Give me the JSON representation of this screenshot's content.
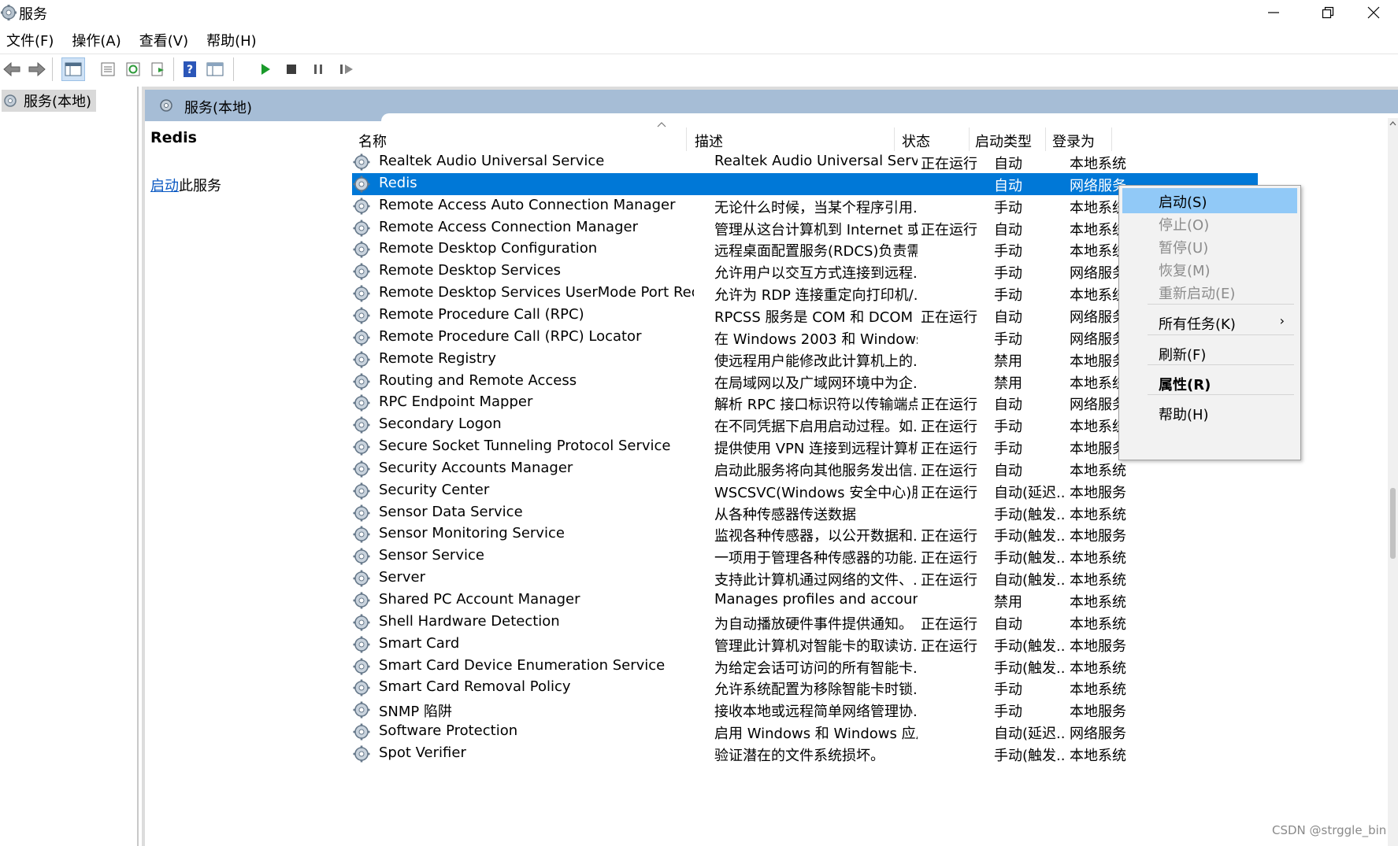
{
  "window": {
    "title": "服务"
  },
  "menu": [
    "文件(F)",
    "操作(A)",
    "查看(V)",
    "帮助(H)"
  ],
  "tree": {
    "root_label": "服务(本地)"
  },
  "pane": {
    "header": "服务(本地)"
  },
  "detail": {
    "service_name": "Redis",
    "action_link": "启动",
    "action_suffix": "此服务"
  },
  "columns": {
    "name": "名称",
    "desc": "描述",
    "status": "状态",
    "startup": "启动类型",
    "logon": "登录为"
  },
  "services": [
    {
      "name": "Realtek Audio Universal Service",
      "desc": "Realtek Audio Universal Service",
      "status": "正在运行",
      "startup": "自动",
      "logon": "本地系统"
    },
    {
      "name": "Redis",
      "desc": "",
      "status": "",
      "startup": "自动",
      "logon": "网络服务"
    },
    {
      "name": "Remote Access Auto Connection Manager",
      "desc": "无论什么时候，当某个程序引用...",
      "status": "",
      "startup": "手动",
      "logon": "本地系统"
    },
    {
      "name": "Remote Access Connection Manager",
      "desc": "管理从这台计算机到 Internet 或...",
      "status": "正在运行",
      "startup": "自动",
      "logon": "本地系统"
    },
    {
      "name": "Remote Desktop Configuration",
      "desc": "远程桌面配置服务(RDCS)负责需...",
      "status": "",
      "startup": "手动",
      "logon": "本地系统"
    },
    {
      "name": "Remote Desktop Services",
      "desc": "允许用户以交互方式连接到远程...",
      "status": "",
      "startup": "手动",
      "logon": "网络服务"
    },
    {
      "name": "Remote Desktop Services UserMode Port Redirector",
      "desc": "允许为 RDP 连接重定向打印机/...",
      "status": "",
      "startup": "手动",
      "logon": "本地系统"
    },
    {
      "name": "Remote Procedure Call (RPC)",
      "desc": "RPCSS 服务是 COM 和 DCOM ...",
      "status": "正在运行",
      "startup": "自动",
      "logon": "网络服务"
    },
    {
      "name": "Remote Procedure Call (RPC) Locator",
      "desc": "在 Windows 2003 和 Windows ...",
      "status": "",
      "startup": "手动",
      "logon": "网络服务"
    },
    {
      "name": "Remote Registry",
      "desc": "使远程用户能修改此计算机上的...",
      "status": "",
      "startup": "禁用",
      "logon": "本地服务"
    },
    {
      "name": "Routing and Remote Access",
      "desc": "在局域网以及广域网环境中为企...",
      "status": "",
      "startup": "禁用",
      "logon": "本地系统"
    },
    {
      "name": "RPC Endpoint Mapper",
      "desc": "解析 RPC 接口标识符以传输端点...",
      "status": "正在运行",
      "startup": "自动",
      "logon": "网络服务"
    },
    {
      "name": "Secondary Logon",
      "desc": "在不同凭据下启用启动过程。如...",
      "status": "正在运行",
      "startup": "手动",
      "logon": "本地系统"
    },
    {
      "name": "Secure Socket Tunneling Protocol Service",
      "desc": "提供使用 VPN 连接到远程计算机...",
      "status": "正在运行",
      "startup": "手动",
      "logon": "本地服务"
    },
    {
      "name": "Security Accounts Manager",
      "desc": "启动此服务将向其他服务发出信...",
      "status": "正在运行",
      "startup": "自动",
      "logon": "本地系统"
    },
    {
      "name": "Security Center",
      "desc": "WSCSVC(Windows 安全中心)服...",
      "status": "正在运行",
      "startup": "自动(延迟...",
      "logon": "本地服务"
    },
    {
      "name": "Sensor Data Service",
      "desc": "从各种传感器传送数据",
      "status": "",
      "startup": "手动(触发...",
      "logon": "本地系统"
    },
    {
      "name": "Sensor Monitoring Service",
      "desc": "监视各种传感器，以公开数据和...",
      "status": "正在运行",
      "startup": "手动(触发...",
      "logon": "本地服务"
    },
    {
      "name": "Sensor Service",
      "desc": "一项用于管理各种传感器的功能...",
      "status": "正在运行",
      "startup": "手动(触发...",
      "logon": "本地系统"
    },
    {
      "name": "Server",
      "desc": "支持此计算机通过网络的文件、...",
      "status": "正在运行",
      "startup": "自动(触发...",
      "logon": "本地系统"
    },
    {
      "name": "Shared PC Account Manager",
      "desc": "Manages profiles and accounts o...",
      "status": "",
      "startup": "禁用",
      "logon": "本地系统"
    },
    {
      "name": "Shell Hardware Detection",
      "desc": "为自动播放硬件事件提供通知。",
      "status": "正在运行",
      "startup": "自动",
      "logon": "本地系统"
    },
    {
      "name": "Smart Card",
      "desc": "管理此计算机对智能卡的取读访...",
      "status": "正在运行",
      "startup": "手动(触发...",
      "logon": "本地服务"
    },
    {
      "name": "Smart Card Device Enumeration Service",
      "desc": "为给定会话可访问的所有智能卡...",
      "status": "",
      "startup": "手动(触发...",
      "logon": "本地系统"
    },
    {
      "name": "Smart Card Removal Policy",
      "desc": "允许系统配置为移除智能卡时锁...",
      "status": "",
      "startup": "手动",
      "logon": "本地系统"
    },
    {
      "name": "SNMP 陷阱",
      "desc": "接收本地或远程简单网络管理协...",
      "status": "",
      "startup": "手动",
      "logon": "本地服务"
    },
    {
      "name": "Software Protection",
      "desc": "启用 Windows 和 Windows 应用...",
      "status": "",
      "startup": "自动(延迟...",
      "logon": "网络服务"
    },
    {
      "name": "Spot Verifier",
      "desc": "验证潜在的文件系统损坏。",
      "status": "",
      "startup": "手动(触发...",
      "logon": "本地系统"
    }
  ],
  "selected_index": 1,
  "context_menu": [
    {
      "label": "启动(S)",
      "state": "highlighted"
    },
    {
      "label": "停止(O)",
      "state": "disabled"
    },
    {
      "label": "暂停(U)",
      "state": "disabled"
    },
    {
      "label": "恢复(M)",
      "state": "disabled"
    },
    {
      "label": "重新启动(E)",
      "state": "disabled"
    },
    {
      "label": "所有任务(K)",
      "state": "submenu"
    },
    {
      "label": "刷新(F)",
      "state": "normal"
    },
    {
      "label": "属性(R)",
      "state": "bold"
    },
    {
      "label": "帮助(H)",
      "state": "normal"
    }
  ],
  "watermark": "CSDN @strggle_bin",
  "colors": {
    "selection": "#0078d7",
    "menu_highlight": "#91c9f7",
    "header_band": "#a6bdd6",
    "link": "#0a58c2"
  }
}
